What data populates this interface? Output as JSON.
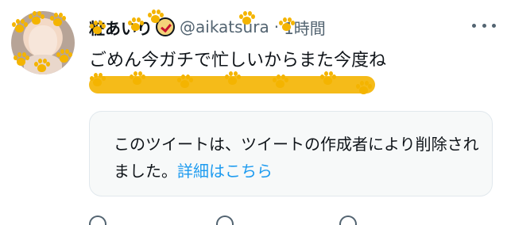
{
  "tweet": {
    "display_name": "粧あいり",
    "handle": "@aikatsura",
    "separator": "·",
    "time": "1時間",
    "text": "ごめん今ガチで忙しいからまた今度ね"
  },
  "deleted_notice": {
    "text": "このツイートは、ツイートの作成者により削除されました。",
    "link": "詳細はこちら"
  },
  "icons": {
    "more": "more-horizontal-icon",
    "verified": "verified-badge-icon",
    "paw": "paw-print-icon"
  },
  "colors": {
    "link": "#1d9bf0",
    "secondary_text": "#536471",
    "paw": "#f4b400"
  }
}
